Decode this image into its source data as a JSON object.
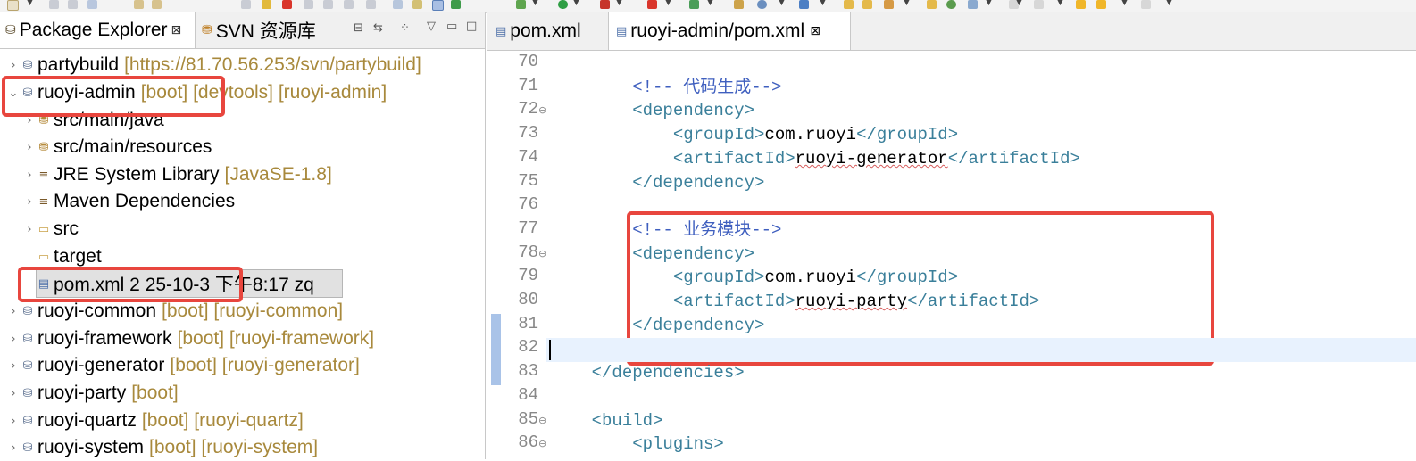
{
  "left_panel": {
    "tabs": [
      {
        "label": "Package Explorer",
        "close": "⊠"
      },
      {
        "label": "SVN 资源库"
      }
    ],
    "tree": [
      {
        "name": "partybuild",
        "decoration": "[https://81.70.56.253/svn/partybuild]",
        "icon": "svn-project-icon"
      },
      {
        "name": "ruoyi-admin",
        "decoration": "[boot] [devtools] [ruoyi-admin]",
        "icon": "maven-project-icon"
      },
      {
        "name": "src/main/java",
        "decoration": "",
        "icon": "source-folder-icon"
      },
      {
        "name": "src/main/resources",
        "decoration": "",
        "icon": "source-folder-icon"
      },
      {
        "name": "JRE System Library",
        "decoration": "[JavaSE-1.8]",
        "icon": "library-icon"
      },
      {
        "name": "Maven Dependencies",
        "decoration": "",
        "icon": "library-icon"
      },
      {
        "name": "src",
        "decoration": "",
        "icon": "folder-icon"
      },
      {
        "name": "target",
        "decoration": "",
        "icon": "folder-icon"
      },
      {
        "name": "pom.xml 2  25-10-3 下午8:17  zq",
        "decoration": "",
        "icon": "xml-file-icon"
      },
      {
        "name": "ruoyi-common",
        "decoration": "[boot] [ruoyi-common]",
        "icon": "maven-project-icon"
      },
      {
        "name": "ruoyi-framework",
        "decoration": "[boot] [ruoyi-framework]",
        "icon": "maven-project-icon"
      },
      {
        "name": "ruoyi-generator",
        "decoration": "[boot] [ruoyi-generator]",
        "icon": "maven-project-icon"
      },
      {
        "name": "ruoyi-party",
        "decoration": "[boot]",
        "icon": "maven-project-icon"
      },
      {
        "name": "ruoyi-quartz",
        "decoration": "[boot] [ruoyi-quartz]",
        "icon": "maven-project-icon"
      },
      {
        "name": "ruoyi-system",
        "decoration": "[boot] [ruoyi-system]",
        "icon": "maven-project-icon"
      }
    ]
  },
  "editor": {
    "tabs": [
      {
        "label": "pom.xml"
      },
      {
        "label": "ruoyi-admin/pom.xml",
        "close": "⊠"
      }
    ],
    "lines": [
      {
        "num": "70",
        "text": ""
      },
      {
        "num": "71",
        "text": "        <!-- 代码生成-->"
      },
      {
        "num": "72",
        "text": "        <dependency>"
      },
      {
        "num": "73",
        "text": "            <groupId>com.ruoyi</groupId>"
      },
      {
        "num": "74",
        "text": "            <artifactId>ruoyi-generator</artifactId>"
      },
      {
        "num": "75",
        "text": "        </dependency>"
      },
      {
        "num": "76",
        "text": ""
      },
      {
        "num": "77",
        "text": "        <!-- 业务模块-->"
      },
      {
        "num": "78",
        "text": "        <dependency>"
      },
      {
        "num": "79",
        "text": "            <groupId>com.ruoyi</groupId>"
      },
      {
        "num": "80",
        "text": "            <artifactId>ruoyi-party</artifactId>"
      },
      {
        "num": "81",
        "text": "        </dependency>"
      },
      {
        "num": "82",
        "text": ""
      },
      {
        "num": "83",
        "text": "    </dependencies>"
      },
      {
        "num": "84",
        "text": ""
      },
      {
        "num": "85",
        "text": "    <build>"
      },
      {
        "num": "86",
        "text": "        <plugins>"
      }
    ]
  },
  "colors": {
    "highlight_box": "#e8463e",
    "xml_tag": "#3a7f9a",
    "xml_comment": "#3f5fbf",
    "decoration": "#a8893c"
  }
}
